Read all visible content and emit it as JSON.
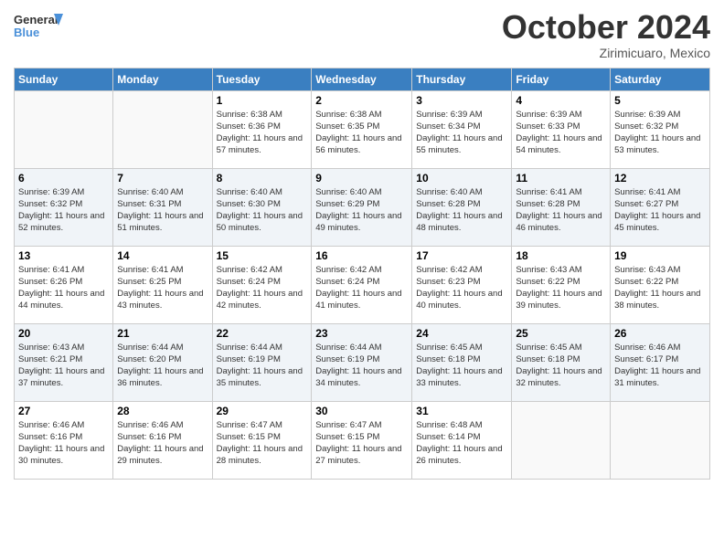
{
  "logo": {
    "line1": "General",
    "line2": "Blue"
  },
  "title": "October 2024",
  "location": "Zirimicuaro, Mexico",
  "days_header": [
    "Sunday",
    "Monday",
    "Tuesday",
    "Wednesday",
    "Thursday",
    "Friday",
    "Saturday"
  ],
  "weeks": [
    [
      {
        "day": "",
        "info": ""
      },
      {
        "day": "",
        "info": ""
      },
      {
        "day": "1",
        "info": "Sunrise: 6:38 AM\nSunset: 6:36 PM\nDaylight: 11 hours and 57 minutes."
      },
      {
        "day": "2",
        "info": "Sunrise: 6:38 AM\nSunset: 6:35 PM\nDaylight: 11 hours and 56 minutes."
      },
      {
        "day": "3",
        "info": "Sunrise: 6:39 AM\nSunset: 6:34 PM\nDaylight: 11 hours and 55 minutes."
      },
      {
        "day": "4",
        "info": "Sunrise: 6:39 AM\nSunset: 6:33 PM\nDaylight: 11 hours and 54 minutes."
      },
      {
        "day": "5",
        "info": "Sunrise: 6:39 AM\nSunset: 6:32 PM\nDaylight: 11 hours and 53 minutes."
      }
    ],
    [
      {
        "day": "6",
        "info": "Sunrise: 6:39 AM\nSunset: 6:32 PM\nDaylight: 11 hours and 52 minutes."
      },
      {
        "day": "7",
        "info": "Sunrise: 6:40 AM\nSunset: 6:31 PM\nDaylight: 11 hours and 51 minutes."
      },
      {
        "day": "8",
        "info": "Sunrise: 6:40 AM\nSunset: 6:30 PM\nDaylight: 11 hours and 50 minutes."
      },
      {
        "day": "9",
        "info": "Sunrise: 6:40 AM\nSunset: 6:29 PM\nDaylight: 11 hours and 49 minutes."
      },
      {
        "day": "10",
        "info": "Sunrise: 6:40 AM\nSunset: 6:28 PM\nDaylight: 11 hours and 48 minutes."
      },
      {
        "day": "11",
        "info": "Sunrise: 6:41 AM\nSunset: 6:28 PM\nDaylight: 11 hours and 46 minutes."
      },
      {
        "day": "12",
        "info": "Sunrise: 6:41 AM\nSunset: 6:27 PM\nDaylight: 11 hours and 45 minutes."
      }
    ],
    [
      {
        "day": "13",
        "info": "Sunrise: 6:41 AM\nSunset: 6:26 PM\nDaylight: 11 hours and 44 minutes."
      },
      {
        "day": "14",
        "info": "Sunrise: 6:41 AM\nSunset: 6:25 PM\nDaylight: 11 hours and 43 minutes."
      },
      {
        "day": "15",
        "info": "Sunrise: 6:42 AM\nSunset: 6:24 PM\nDaylight: 11 hours and 42 minutes."
      },
      {
        "day": "16",
        "info": "Sunrise: 6:42 AM\nSunset: 6:24 PM\nDaylight: 11 hours and 41 minutes."
      },
      {
        "day": "17",
        "info": "Sunrise: 6:42 AM\nSunset: 6:23 PM\nDaylight: 11 hours and 40 minutes."
      },
      {
        "day": "18",
        "info": "Sunrise: 6:43 AM\nSunset: 6:22 PM\nDaylight: 11 hours and 39 minutes."
      },
      {
        "day": "19",
        "info": "Sunrise: 6:43 AM\nSunset: 6:22 PM\nDaylight: 11 hours and 38 minutes."
      }
    ],
    [
      {
        "day": "20",
        "info": "Sunrise: 6:43 AM\nSunset: 6:21 PM\nDaylight: 11 hours and 37 minutes."
      },
      {
        "day": "21",
        "info": "Sunrise: 6:44 AM\nSunset: 6:20 PM\nDaylight: 11 hours and 36 minutes."
      },
      {
        "day": "22",
        "info": "Sunrise: 6:44 AM\nSunset: 6:19 PM\nDaylight: 11 hours and 35 minutes."
      },
      {
        "day": "23",
        "info": "Sunrise: 6:44 AM\nSunset: 6:19 PM\nDaylight: 11 hours and 34 minutes."
      },
      {
        "day": "24",
        "info": "Sunrise: 6:45 AM\nSunset: 6:18 PM\nDaylight: 11 hours and 33 minutes."
      },
      {
        "day": "25",
        "info": "Sunrise: 6:45 AM\nSunset: 6:18 PM\nDaylight: 11 hours and 32 minutes."
      },
      {
        "day": "26",
        "info": "Sunrise: 6:46 AM\nSunset: 6:17 PM\nDaylight: 11 hours and 31 minutes."
      }
    ],
    [
      {
        "day": "27",
        "info": "Sunrise: 6:46 AM\nSunset: 6:16 PM\nDaylight: 11 hours and 30 minutes."
      },
      {
        "day": "28",
        "info": "Sunrise: 6:46 AM\nSunset: 6:16 PM\nDaylight: 11 hours and 29 minutes."
      },
      {
        "day": "29",
        "info": "Sunrise: 6:47 AM\nSunset: 6:15 PM\nDaylight: 11 hours and 28 minutes."
      },
      {
        "day": "30",
        "info": "Sunrise: 6:47 AM\nSunset: 6:15 PM\nDaylight: 11 hours and 27 minutes."
      },
      {
        "day": "31",
        "info": "Sunrise: 6:48 AM\nSunset: 6:14 PM\nDaylight: 11 hours and 26 minutes."
      },
      {
        "day": "",
        "info": ""
      },
      {
        "day": "",
        "info": ""
      }
    ]
  ]
}
